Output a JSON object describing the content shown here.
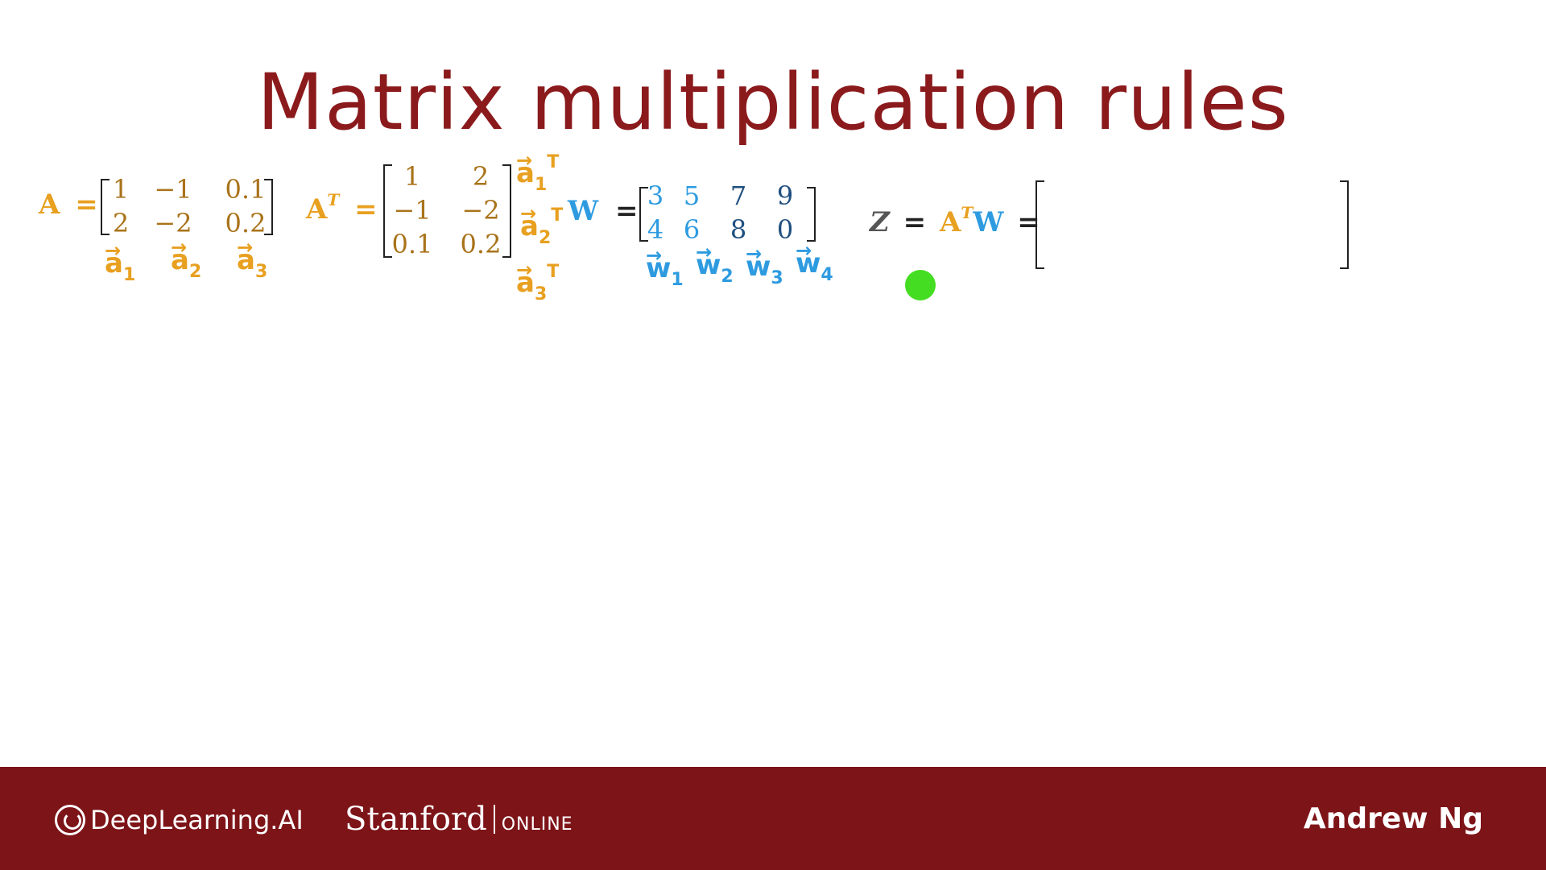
{
  "slide": {
    "title": "Matrix multiplication rules"
  },
  "matrix_A": {
    "label": "A",
    "equals": "=",
    "rows": [
      [
        "1",
        "−1",
        "0.1"
      ],
      [
        "2",
        "−2",
        "0.2"
      ]
    ],
    "column_labels": [
      {
        "letter": "a",
        "sub": "1"
      },
      {
        "letter": "a",
        "sub": "2"
      },
      {
        "letter": "a",
        "sub": "3"
      }
    ]
  },
  "matrix_AT": {
    "label": "A",
    "sup": "T",
    "equals": "=",
    "rows": [
      [
        "1",
        "2"
      ],
      [
        "−1",
        "−2"
      ],
      [
        "0.1",
        "0.2"
      ]
    ],
    "row_labels": [
      {
        "letter": "a",
        "sub": "1",
        "sup": "T"
      },
      {
        "letter": "a",
        "sub": "2",
        "sup": "T"
      },
      {
        "letter": "a",
        "sub": "3",
        "sup": "T"
      }
    ]
  },
  "matrix_W": {
    "label": "W",
    "equals": "=",
    "rows": [
      [
        "3",
        "5",
        "7",
        "9"
      ],
      [
        "4",
        "6",
        "8",
        "0"
      ]
    ],
    "column_labels": [
      {
        "letter": "w",
        "sub": "1"
      },
      {
        "letter": "w",
        "sub": "2"
      },
      {
        "letter": "w",
        "sub": "3"
      },
      {
        "letter": "w",
        "sub": "4"
      }
    ]
  },
  "equation_Z": {
    "z": "Z",
    "equals1": "=",
    "a": "A",
    "sup": "T",
    "w": "W",
    "equals2": "="
  },
  "footer": {
    "brand": "DeepLearning.AI",
    "university": "Stanford",
    "online": "ONLINE",
    "author": "Andrew Ng"
  },
  "colors": {
    "title": "#8b1a1c",
    "orange": "#e8a020",
    "blue": "#2e9be0",
    "footer_bg": "#7d1418",
    "cursor": "#44dd22"
  }
}
